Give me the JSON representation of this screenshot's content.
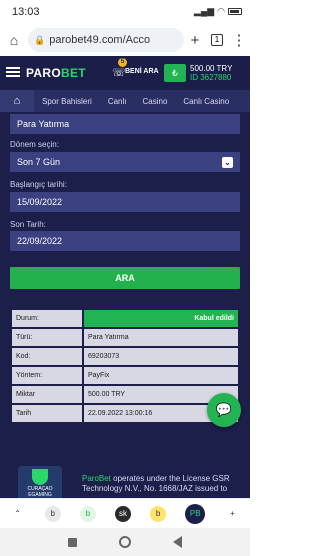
{
  "status": {
    "time": "13:03",
    "battery_icon": "battery-icon",
    "wifi_icon": "wifi-icon"
  },
  "browser": {
    "url": "parobet49.com/Acco",
    "tab_count": "1"
  },
  "nav": {
    "logo_a": "PARO",
    "logo_b": "BET",
    "beni_ara": "BENİ ARA",
    "badge": "5",
    "balance": "500.00 TRY",
    "user_id": "ID 3627880"
  },
  "menu": {
    "items": [
      "Spor Bahisleri",
      "Canlı",
      "Casino",
      "Canlı Casino"
    ]
  },
  "form": {
    "type_select": "Para Yatırma",
    "period_label": "Dönem seçin:",
    "period_select": "Son 7 Gün",
    "start_label": "Başlangıç tarihi:",
    "start_value": "15/09/2022",
    "end_label": "Son Tarih:",
    "end_value": "22/09/2022",
    "search_button": "ARA"
  },
  "table": {
    "rows": [
      {
        "k": "Durum:",
        "v": "Kabul edildi"
      },
      {
        "k": "Türü:",
        "v": "Para Yatırma"
      },
      {
        "k": "Kod:",
        "v": "69203073"
      },
      {
        "k": "Yöntem:",
        "v": "PayFix"
      },
      {
        "k": "Miktar",
        "v": "500.00 TRY"
      },
      {
        "k": "Tarih",
        "v": "22.09.2022 13:00:16"
      }
    ]
  },
  "footer": {
    "curacao": "CURAÇAO EGAMING",
    "brand": "ParoBet",
    "license_text": " operates under the License GSR Technology N.V., No. 1668/JAZ issued to"
  },
  "bottombar": [
    "b",
    "b",
    "sk",
    "b",
    "PB"
  ],
  "colors": {
    "accent": "#22b352",
    "bg": "#1b1f4a",
    "field": "#3a4080"
  }
}
